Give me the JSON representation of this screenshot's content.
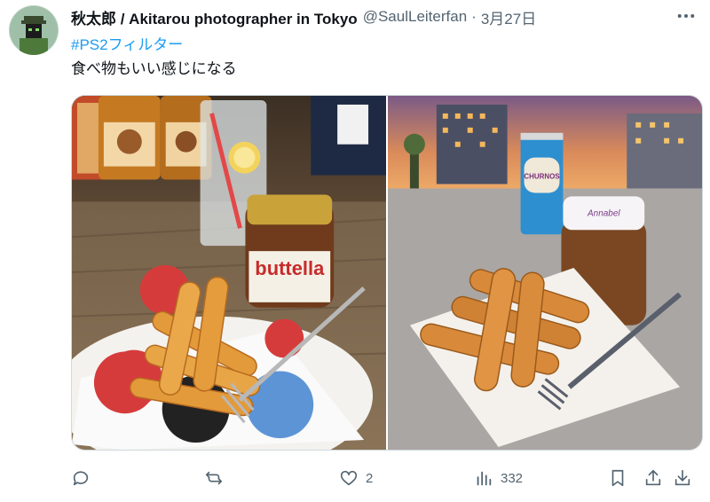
{
  "tweet": {
    "author_name": "秋太郎 / Akitarou photographer in Tokyo",
    "handle": "@SaulLeiterfan",
    "separator": "·",
    "date": "3月27日",
    "hashtag": "#PS2フィルター",
    "text": "食べ物もいい感じになる"
  },
  "images": {
    "left_jar_label": "buttella",
    "right_jar_lid_text": "Annabel",
    "right_can_text": "CHURNOS"
  },
  "actions": {
    "reply_count": "",
    "retweet_count": "",
    "like_count": "2",
    "view_count": "332"
  },
  "colors": {
    "link": "#1d9bf0",
    "muted": "#536471"
  }
}
